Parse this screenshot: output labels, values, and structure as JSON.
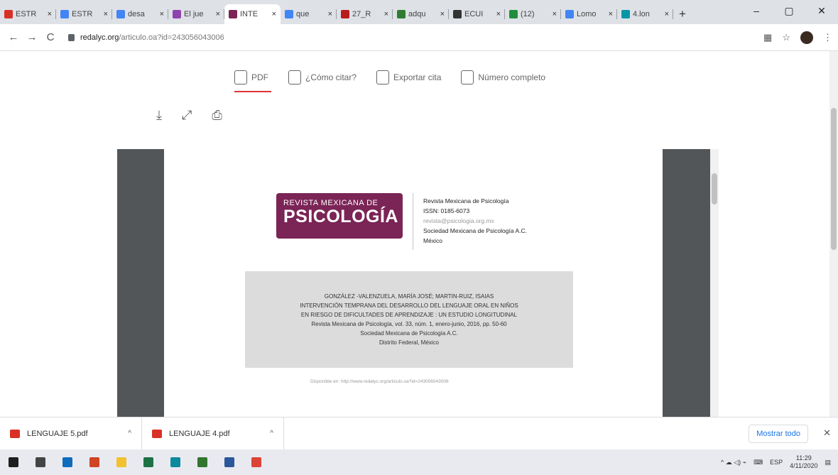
{
  "tabs": [
    {
      "title": "ESTR",
      "color": "#d93025",
      "active": false
    },
    {
      "title": "ESTR",
      "color": "#4285f4",
      "active": false
    },
    {
      "title": "desa",
      "color": "#4285f4",
      "active": false
    },
    {
      "title": "El jue",
      "color": "#8e44ad",
      "active": false
    },
    {
      "title": "INTE",
      "color": "#7b2456",
      "active": true
    },
    {
      "title": "que",
      "color": "#4285f4",
      "active": false
    },
    {
      "title": "27_R",
      "color": "#b71c1c",
      "active": false
    },
    {
      "title": "adqu",
      "color": "#2e7d32",
      "active": false
    },
    {
      "title": "ECUI",
      "color": "#333333",
      "active": false
    },
    {
      "title": "(12)",
      "color": "#1e8e3e",
      "active": false
    },
    {
      "title": "Lomo",
      "color": "#4285f4",
      "active": false
    },
    {
      "title": "4.lon",
      "color": "#0097a7",
      "active": false
    }
  ],
  "tab_close_glyph": "×",
  "new_tab_glyph": "+",
  "window": {
    "minimize": "–",
    "maximize": "▢",
    "close": "✕"
  },
  "nav": {
    "back": "←",
    "forward": "→",
    "reload": "C"
  },
  "url": {
    "host": "redalyc.org",
    "path": "/articulo.oa?id=243056043006"
  },
  "page_actions": [
    {
      "label": "PDF",
      "icon": "pdf-icon",
      "selected": true
    },
    {
      "label": "¿Cómo citar?",
      "icon": "quote-icon",
      "selected": false
    },
    {
      "label": "Exportar cita",
      "icon": "export-citation-icon",
      "selected": false
    },
    {
      "label": "Número completo",
      "icon": "full-issue-icon",
      "selected": false
    }
  ],
  "pdf_tools": {
    "download": "⤓",
    "fullscreen": "⤢",
    "print": "⎙"
  },
  "logo": {
    "line1": "REVISTA MEXICANA DE",
    "line2": "PSICOLOGÍA"
  },
  "journal": {
    "name": "Revista Mexicana de Psicología",
    "issn": "ISSN: 0185-6073",
    "email": "revista@psicologia.org.mx",
    "society": "Sociedad Mexicana de Psicología A.C.",
    "country": "México"
  },
  "citation": {
    "authors": "GONZÁLEZ -VALENZUELA, MARÍA JOSÉ; MARTIN-RUIZ, ISAIAS",
    "title1": "INTERVENCIÓN TEMPRANA DEL DESARROLLO DEL LENGUAJE ORAL EN NIÑOS",
    "title2": "EN RIESGO DE DIFICULTADES DE APRENDIZAJE : UN ESTUDIO LONGITUDINAL",
    "source": "Revista Mexicana de Psicología, vol. 33, núm. 1, enero-junio, 2016, pp. 50-60",
    "publisher": "Sociedad Mexicana de Psicología A.C.",
    "place": "Distrito Federal, México"
  },
  "available": "Disponible en: http://www.redalyc.org/articulo.oa?id=243056043006",
  "downloads": [
    {
      "name": "LENGUAJE 5.pdf"
    },
    {
      "name": "LENGUAJE 4.pdf"
    }
  ],
  "download_caret": "^",
  "show_all": "Mostrar todo",
  "download_close": "✕",
  "taskbar_apps": [
    {
      "name": "start-icon",
      "color": "#1f1f1f"
    },
    {
      "name": "task-view-icon",
      "color": "#444"
    },
    {
      "name": "outlook-icon",
      "color": "#0f6cbd"
    },
    {
      "name": "powerpoint-icon",
      "color": "#d04423"
    },
    {
      "name": "file-explorer-icon",
      "color": "#f2c12e"
    },
    {
      "name": "excel-icon",
      "color": "#1e7145"
    },
    {
      "name": "edge-icon",
      "color": "#0e8a9e"
    },
    {
      "name": "project-icon",
      "color": "#31752f"
    },
    {
      "name": "word-icon",
      "color": "#2b579a"
    },
    {
      "name": "chrome-icon",
      "color": "#db4437"
    }
  ],
  "tray": {
    "lang": "ESP",
    "time": "11:29",
    "date": "4/11/2020"
  }
}
